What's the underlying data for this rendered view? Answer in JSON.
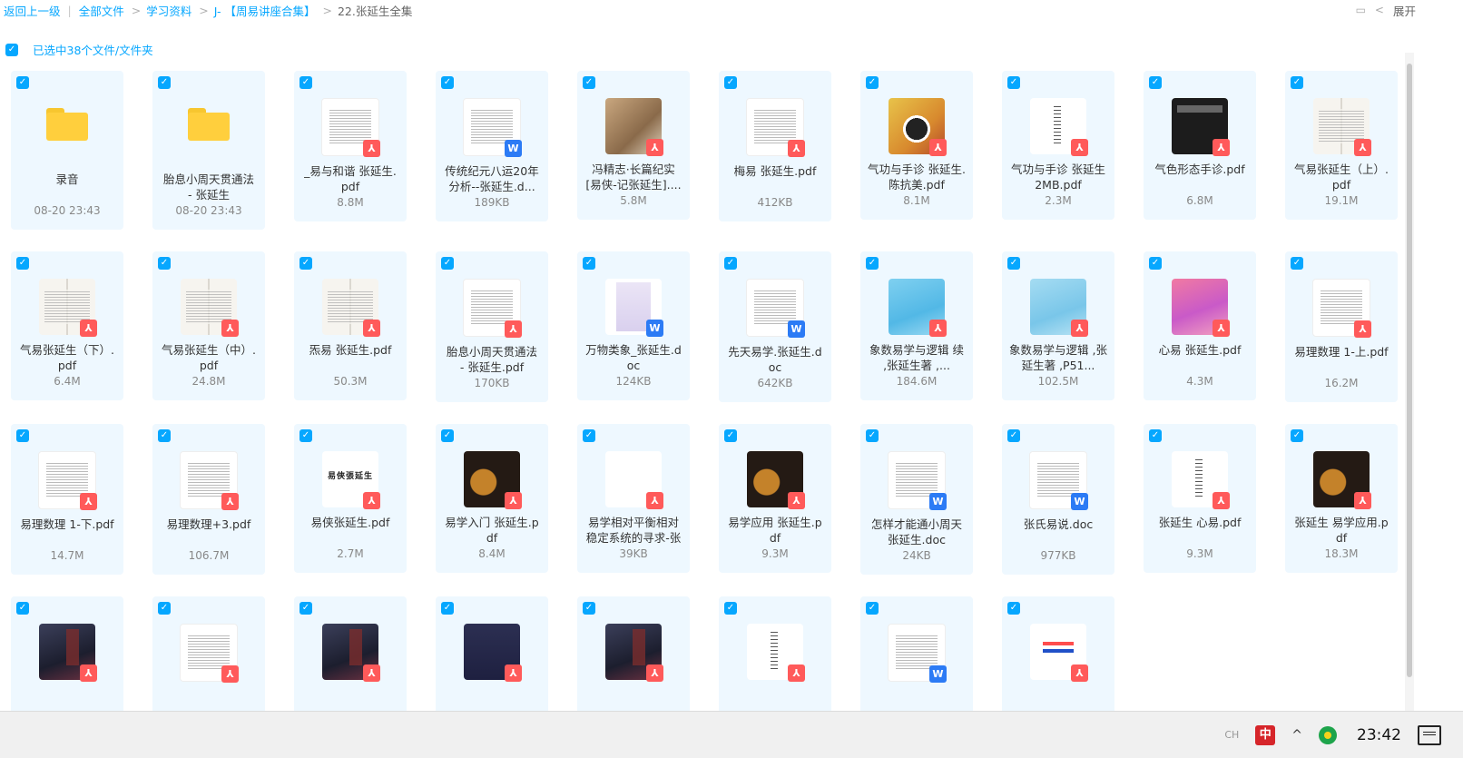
{
  "breadcrumb": {
    "back": "返回上一级",
    "items": [
      "全部文件",
      "学习资料",
      "J- 【周易讲座合集】"
    ],
    "current": "22.张延生全集"
  },
  "top_right": {
    "expand_label": "展开",
    "expand_icon": "chevron-left-icon",
    "view_icon": "list-view-icon"
  },
  "selection": {
    "text": "已选中38个文件/文件夹",
    "checked": true
  },
  "colors": {
    "accent": "#06a7ff",
    "tile_bg": "#eef8ff",
    "pdf": "#ff5a5a",
    "doc": "#2c7bf5",
    "folder": "#ffcf3d"
  },
  "files": [
    {
      "name": "录音",
      "meta": "08-20 23:43",
      "kind": "folder",
      "thumb": "folder"
    },
    {
      "name": "胎息小周天贯通法 - 张延生",
      "meta": "08-20 23:43",
      "kind": "folder",
      "thumb": "folder"
    },
    {
      "name": "_易与和谐 张延生.pdf",
      "meta": "8.8M",
      "kind": "pdf",
      "thumb": "t-doc"
    },
    {
      "name": "传统纪元八运20年分析--张延生.d...",
      "meta": "189KB",
      "kind": "doc",
      "thumb": "t-doc"
    },
    {
      "name": "冯精志·长篇纪实[易侠-记张延生]....",
      "meta": "5.8M",
      "kind": "pdf",
      "thumb": "t-photo"
    },
    {
      "name": "梅易 张延生.pdf",
      "meta": "412KB",
      "kind": "pdf",
      "thumb": "t-doc"
    },
    {
      "name": "气功与手诊 张延生.陈抗美.pdf",
      "meta": "8.1M",
      "kind": "pdf",
      "thumb": "t-hand"
    },
    {
      "name": "气功与手诊 张延生2MB.pdf",
      "meta": "2.3M",
      "kind": "pdf",
      "thumb": "t-text-center"
    },
    {
      "name": "气色形态手诊.pdf",
      "meta": "6.8M",
      "kind": "pdf",
      "thumb": "t-black"
    },
    {
      "name": "气易张延生（上）.pdf",
      "meta": "19.1M",
      "kind": "pdf",
      "thumb": "t-book"
    },
    {
      "name": "气易张延生（下）.pdf",
      "meta": "6.4M",
      "kind": "pdf",
      "thumb": "t-book"
    },
    {
      "name": "气易张延生（中）.pdf",
      "meta": "24.8M",
      "kind": "pdf",
      "thumb": "t-book"
    },
    {
      "name": "炁易 张延生.pdf",
      "meta": "50.3M",
      "kind": "pdf",
      "thumb": "t-book"
    },
    {
      "name": "胎息小周天贯通法 - 张延生.pdf",
      "meta": "170KB",
      "kind": "pdf",
      "thumb": "t-doc"
    },
    {
      "name": "万物类象_张延生.doc",
      "meta": "124KB",
      "kind": "doc",
      "thumb": "t-violet"
    },
    {
      "name": "先天易学.张延生.doc",
      "meta": "642KB",
      "kind": "doc",
      "thumb": "t-doc"
    },
    {
      "name": "象数易学与逻辑 续 ,张延生著 ,...",
      "meta": "184.6M",
      "kind": "pdf",
      "thumb": "t-blue"
    },
    {
      "name": "象数易学与逻辑 ,张延生著 ,P51...",
      "meta": "102.5M",
      "kind": "pdf",
      "thumb": "t-blue2"
    },
    {
      "name": "心易 张延生.pdf",
      "meta": "4.3M",
      "kind": "pdf",
      "thumb": "t-pink"
    },
    {
      "name": "易理数理 1-上.pdf",
      "meta": "16.2M",
      "kind": "pdf",
      "thumb": "t-doc"
    },
    {
      "name": "易理数理 1-下.pdf",
      "meta": "14.7M",
      "kind": "pdf",
      "thumb": "t-doc"
    },
    {
      "name": "易理数理+3.pdf",
      "meta": "106.7M",
      "kind": "pdf",
      "thumb": "t-doc"
    },
    {
      "name": "易侠张延生.pdf",
      "meta": "2.7M",
      "kind": "pdf",
      "thumb": "t-calli"
    },
    {
      "name": "易学入门 张延生.pdf",
      "meta": "8.4M",
      "kind": "pdf",
      "thumb": "t-yi"
    },
    {
      "name": "易学相对平衡相对稳定系统的寻求-张",
      "meta": "39KB",
      "kind": "pdf",
      "thumb": "t-blank"
    },
    {
      "name": "易学应用 张延生.pdf",
      "meta": "9.3M",
      "kind": "pdf",
      "thumb": "t-yi"
    },
    {
      "name": "怎样才能通小周天 张延生.doc",
      "meta": "24KB",
      "kind": "doc",
      "thumb": "t-doc"
    },
    {
      "name": "张氏易说.doc",
      "meta": "977KB",
      "kind": "doc",
      "thumb": "t-doc"
    },
    {
      "name": "张延生 心易.pdf",
      "meta": "9.3M",
      "kind": "pdf",
      "thumb": "t-text-center"
    },
    {
      "name": "张延生 易学应用.pdf",
      "meta": "18.3M",
      "kind": "pdf",
      "thumb": "t-yi"
    },
    {
      "name": "",
      "meta": "",
      "kind": "pdf",
      "thumb": "t-night"
    },
    {
      "name": "",
      "meta": "",
      "kind": "pdf",
      "thumb": "t-doc"
    },
    {
      "name": "",
      "meta": "",
      "kind": "pdf",
      "thumb": "t-night"
    },
    {
      "name": "",
      "meta": "",
      "kind": "pdf",
      "thumb": "t-navy"
    },
    {
      "name": "",
      "meta": "",
      "kind": "pdf",
      "thumb": "t-night"
    },
    {
      "name": "",
      "meta": "",
      "kind": "pdf",
      "thumb": "t-text-center"
    },
    {
      "name": "",
      "meta": "",
      "kind": "doc",
      "thumb": "t-doc"
    },
    {
      "name": "",
      "meta": "",
      "kind": "pdf",
      "thumb": "t-cal"
    }
  ],
  "taskbar": {
    "lang": "CH",
    "ime_glyph": "中",
    "clock": "23:42",
    "icons": [
      "ime-icon",
      "chevron-up-icon",
      "network-icon",
      "notification-icon"
    ]
  }
}
